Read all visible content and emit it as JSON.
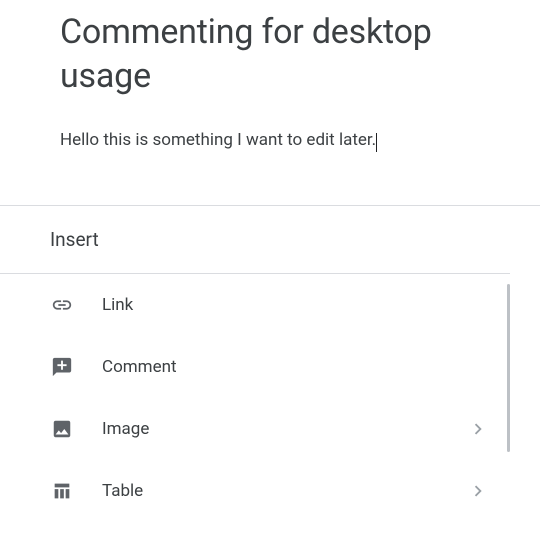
{
  "document": {
    "title": "Commenting for desktop usage",
    "body_text": "Hello this is something I want to edit later."
  },
  "insert_panel": {
    "header": "Insert",
    "items": [
      {
        "icon": "link-icon",
        "label": "Link",
        "has_submenu": false
      },
      {
        "icon": "comment-icon",
        "label": "Comment",
        "has_submenu": false
      },
      {
        "icon": "image-icon",
        "label": "Image",
        "has_submenu": true
      },
      {
        "icon": "table-icon",
        "label": "Table",
        "has_submenu": true
      }
    ]
  }
}
